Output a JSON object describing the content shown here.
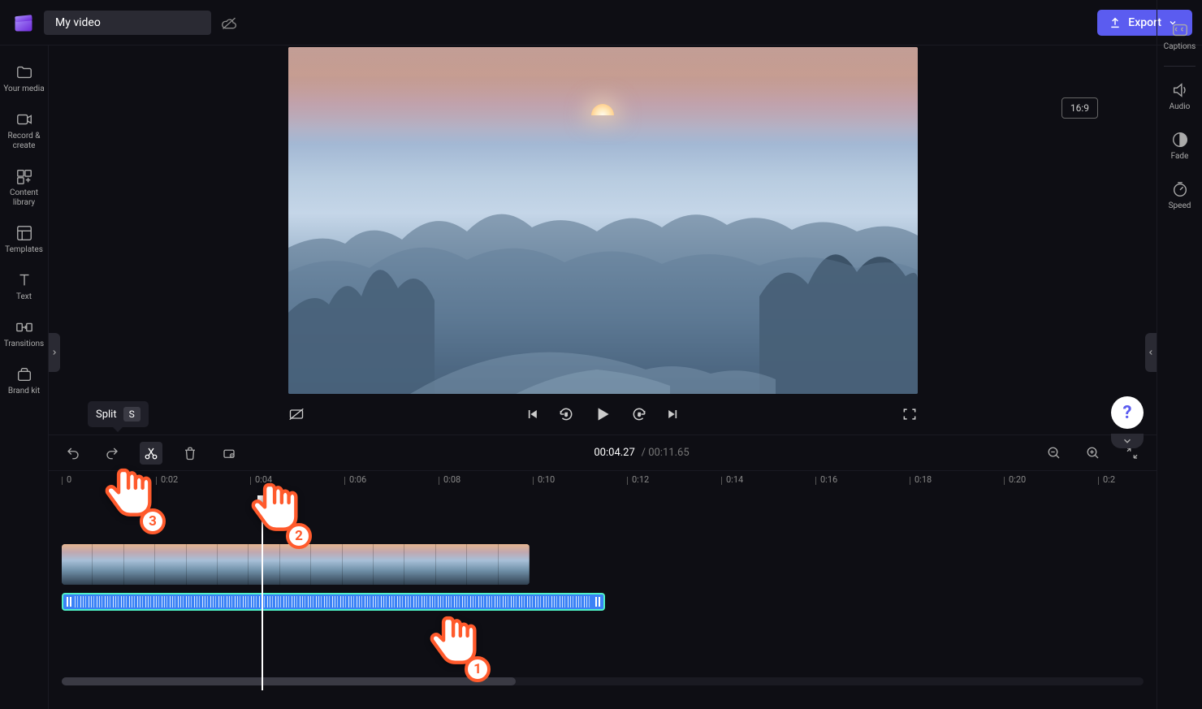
{
  "header": {
    "title": "My video",
    "export_label": "Export"
  },
  "aspect_ratio": "16:9",
  "sidebar_left": {
    "items": [
      {
        "label": "Your media"
      },
      {
        "label": "Record & create"
      },
      {
        "label": "Content library"
      },
      {
        "label": "Templates"
      },
      {
        "label": "Text"
      },
      {
        "label": "Transitions"
      },
      {
        "label": "Brand kit"
      }
    ]
  },
  "sidebar_right": {
    "items": [
      {
        "label": "Captions"
      },
      {
        "label": "Audio"
      },
      {
        "label": "Fade"
      },
      {
        "label": "Speed"
      }
    ]
  },
  "time": {
    "current": "00:04.27",
    "total": "00:11.65"
  },
  "split_tooltip": {
    "label": "Split",
    "shortcut": "S"
  },
  "ruler": {
    "ticks": [
      "0",
      "0:02",
      "0:04",
      "0:06",
      "0:08",
      "0:10",
      "0:12",
      "0:14",
      "0:16",
      "0:18",
      "0:20",
      "0:2"
    ]
  },
  "annotations": {
    "hand1": "1",
    "hand2": "2",
    "hand3": "3"
  }
}
